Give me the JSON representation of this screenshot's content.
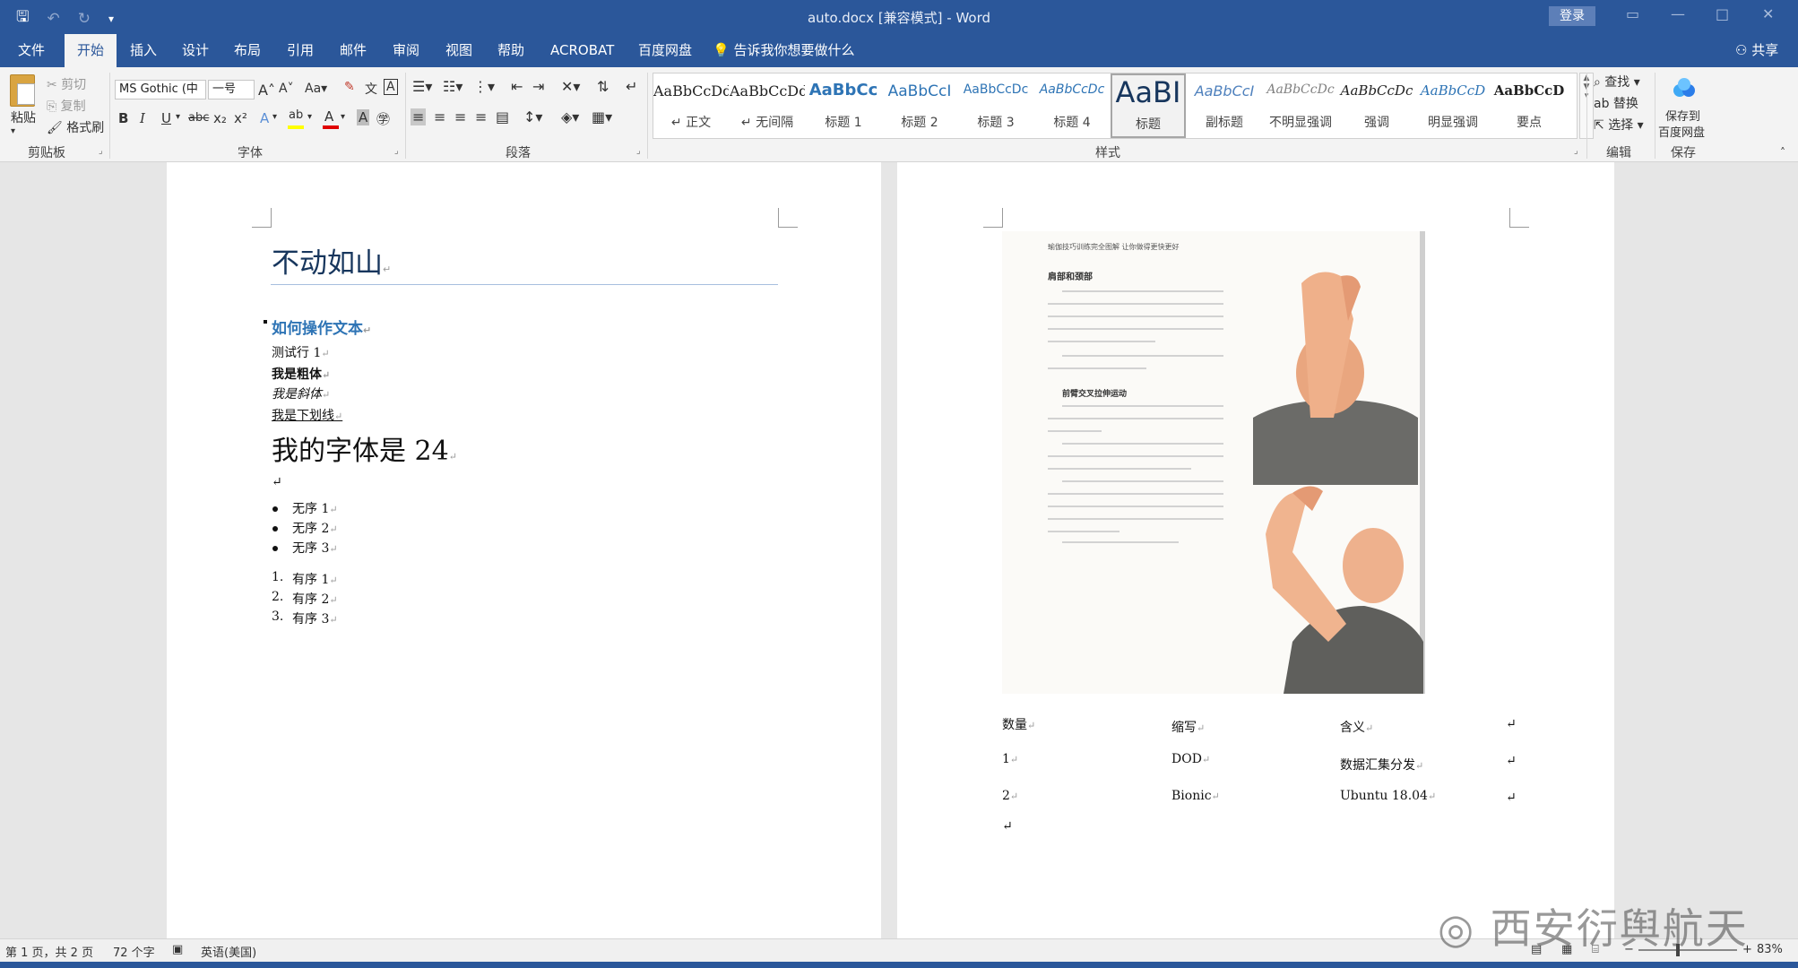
{
  "window": {
    "title": "auto.docx [兼容模式]  -  Word",
    "login": "登录",
    "share": "共享",
    "tell_me": "告诉我你想要做什么"
  },
  "tabs": [
    "文件",
    "开始",
    "插入",
    "设计",
    "布局",
    "引用",
    "邮件",
    "审阅",
    "视图",
    "帮助",
    "ACROBAT",
    "百度网盘"
  ],
  "active_tab": "开始",
  "ribbon": {
    "clipboard": {
      "label": "剪贴板",
      "paste": "粘贴",
      "cut": "剪切",
      "copy": "复制",
      "format_painter": "格式刷"
    },
    "font": {
      "label": "字体",
      "font_name": "MS Gothic (中",
      "font_size": "一号",
      "grow": "A",
      "shrink": "A",
      "case": "Aa",
      "bold": "B",
      "italic": "I",
      "underline": "U",
      "strike": "abc",
      "subscript": "x₂",
      "superscript": "x²",
      "highlight": "ab",
      "font_color": "A"
    },
    "paragraph": {
      "label": "段落"
    },
    "styles": {
      "label": "样式",
      "items": [
        {
          "preview": "AaBbCcDd",
          "name": "正文"
        },
        {
          "preview": "AaBbCcDd",
          "name": "无间隔"
        },
        {
          "preview": "AaBbCc",
          "name": "标题 1"
        },
        {
          "preview": "AaBbCcI",
          "name": "标题 2"
        },
        {
          "preview": "AaBbCcDc",
          "name": "标题 3"
        },
        {
          "preview": "AaBbCcDc",
          "name": "标题 4"
        },
        {
          "preview": "AaBI",
          "name": "标题"
        },
        {
          "preview": "AaBbCcI",
          "name": "副标题"
        },
        {
          "preview": "AaBbCcDc",
          "name": "不明显强调"
        },
        {
          "preview": "AaBbCcDc",
          "name": "强调"
        },
        {
          "preview": "AaBbCcD",
          "name": "明显强调"
        },
        {
          "preview": "AaBbCcD",
          "name": "要点"
        }
      ]
    },
    "editing": {
      "label": "编辑",
      "find": "查找",
      "replace": "替换",
      "select": "选择"
    },
    "save": {
      "label": "保存",
      "button_line1": "保存到",
      "button_line2": "百度网盘"
    }
  },
  "document": {
    "title": "不动如山",
    "heading1": "如何操作文本",
    "lines": [
      "测试行 1",
      "我是粗体",
      "我是斜体",
      "我是下划线"
    ],
    "font24": "我的字体是 24",
    "unordered": [
      "无序 1",
      "无序 2",
      "无序 3"
    ],
    "ordered": [
      "有序 1",
      "有序 2",
      "有序 3"
    ],
    "ordered_numbers": [
      "1.",
      "2.",
      "3."
    ],
    "scan_header": "瑜伽技巧训练完全图解   让你做得更快更好",
    "scan_heading": "肩部和颈部",
    "scan_subheading": "前臂交叉拉伸运动",
    "table": {
      "headers": [
        "数量",
        "缩写",
        "含义"
      ],
      "rows": [
        [
          "1",
          "DOD",
          "数据汇集分发"
        ],
        [
          "2",
          "Bionic",
          "Ubuntu 18.04"
        ]
      ]
    }
  },
  "status": {
    "page": "第 1 页，共 2 页",
    "words": "72 个字",
    "language": "英语(美国)",
    "zoom": "83%"
  },
  "watermark": "西安衍舆航天",
  "colors": {
    "accent": "#2b579a",
    "title": "#17365d",
    "heading": "#2e74b5"
  }
}
